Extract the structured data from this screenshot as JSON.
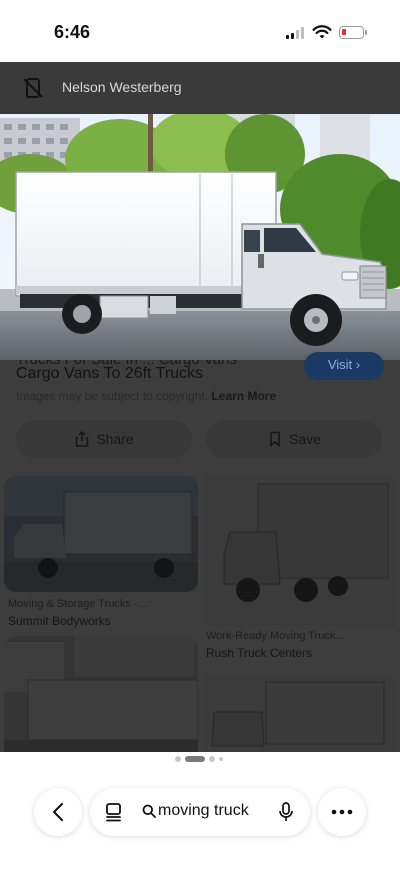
{
  "status_bar": {
    "time": "6:46"
  },
  "source": {
    "name": "Nelson Westerberg",
    "icon": "no-phone-icon"
  },
  "result": {
    "title_partial": "Trucks For Sale In ... Cargo Vans",
    "title": "Cargo Vans To 26ft Trucks",
    "visit_label": "Visit",
    "copyright_text": "Images may be subject to copyright.",
    "learn_more_label": "Learn More"
  },
  "actions": {
    "share_label": "Share",
    "save_label": "Save"
  },
  "related": [
    {
      "title": "Moving & Storage Trucks -...",
      "source": "Summit Bodyworks"
    },
    {
      "title": "Work-Ready Moving Truck...",
      "source": "Rush Truck Centers"
    }
  ],
  "pager": {
    "active_index": 1,
    "count": 4
  },
  "toolbar": {
    "query": "moving truck",
    "back_icon": "chevron-left-icon",
    "tabs_icon": "tabs-icon",
    "search_icon": "search-icon",
    "mic_icon": "mic-icon",
    "more_icon": "more-icon"
  },
  "colors": {
    "overlay": "#3d3d3d",
    "visit_button": "#1b3a63",
    "battery_low": "#e0312b"
  }
}
